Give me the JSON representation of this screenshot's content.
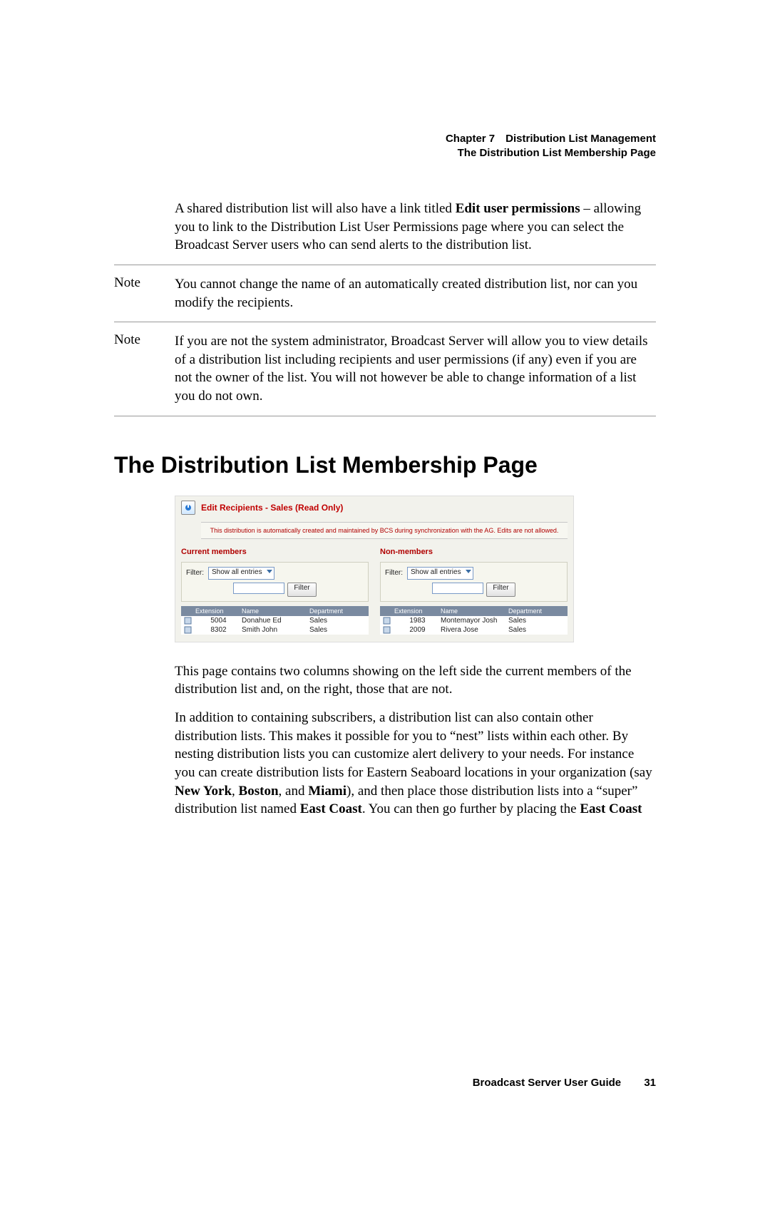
{
  "header": {
    "chapter_line": "Chapter 7 Distribution List Management",
    "section_line": "The Distribution List Membership Page"
  },
  "intro_para": "A shared distribution list will also have a link titled ",
  "intro_bold": "Edit user permissions",
  "intro_rest": " – allowing you to link to the Distribution List User Permissions page where you can select the Broadcast Server users who can send alerts to the distribution list.",
  "note_label": "Note",
  "note1": "You cannot change the name of an automatically created distribution list, nor can you modify the recipients.",
  "note2": "If you are not the system administrator, Broadcast Server will allow you to view details of a distribution list including recipients and user permissions (if any) even if you are not the owner of the list. You will not however be able to change information of a list you do not own.",
  "section_title": "The Distribution List Membership Page",
  "figure": {
    "title": "Edit Recipients - Sales (Read Only)",
    "notice": "This distribution is automatically created and maintained by BCS during synchronization with the AG. Edits are not allowed.",
    "left_title": "Current members",
    "right_title": "Non-members",
    "filter_label": "Filter:",
    "filter_option": "Show all entries",
    "filter_button": "Filter",
    "headers": {
      "ext": "Extension",
      "name": "Name",
      "dept": "Department"
    },
    "left_rows": [
      {
        "ext": "5004",
        "name": "Donahue Ed",
        "dept": "Sales"
      },
      {
        "ext": "8302",
        "name": "Smith John",
        "dept": "Sales"
      }
    ],
    "right_rows": [
      {
        "ext": "1983",
        "name": "Montemayor Josh",
        "dept": "Sales"
      },
      {
        "ext": "2009",
        "name": "Rivera Jose",
        "dept": "Sales"
      }
    ]
  },
  "para1": "This page contains two columns showing on the left side the current members of the distribution list and, on the right, those that are not.",
  "para2_a": "In addition to containing subscribers, a distribution list can also contain other distribution lists. This makes it possible for you to “nest” lists within each other. By nesting distribution lists you can customize alert delivery to your needs. For instance you can create distribution lists for Eastern Seaboard locations in your organization (say ",
  "para2_b1": "New York",
  "para2_b1s": ", ",
  "para2_b2": "Boston",
  "para2_b2s": ", and ",
  "para2_b3": "Miami",
  "para2_c": "), and then place those distribution lists into a “super” distribution list named ",
  "para2_b4": "East Coast",
  "para2_d": ". You can then go further by placing the ",
  "para2_b5": "East Coast",
  "footer": {
    "guide": "Broadcast Server User Guide",
    "page": "31"
  }
}
